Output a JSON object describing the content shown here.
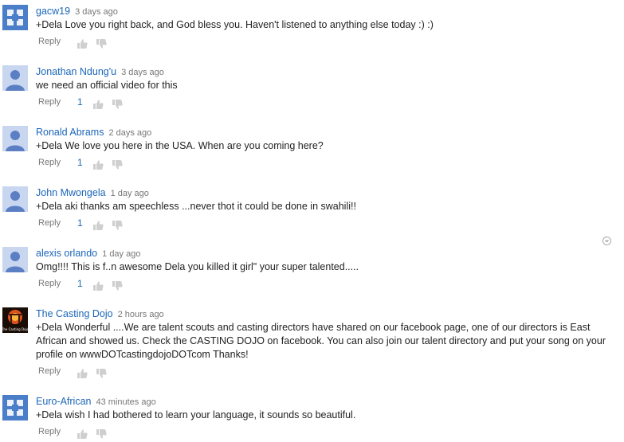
{
  "comments": [
    {
      "author": "gacw19",
      "time": "3 days ago",
      "text": "+Dela Love you right back, and God bless you. Haven't listened to anything else today :) :)",
      "reply_label": "Reply",
      "likes": "",
      "avatar": "blue"
    },
    {
      "author": "Jonathan Ndung'u",
      "time": "3 days ago",
      "text": "we need an official video for this",
      "reply_label": "Reply",
      "likes": "1",
      "avatar": "person"
    },
    {
      "author": "Ronald Abrams",
      "time": "2 days ago",
      "text": "+Dela We love you here in the USA.  When are you coming here?",
      "reply_label": "Reply",
      "likes": "1",
      "avatar": "person"
    },
    {
      "author": "John Mwongela",
      "time": "1 day ago",
      "text": "+Dela aki thanks  am speechless ...never thot it could be done in swahili!!",
      "reply_label": "Reply",
      "likes": "1",
      "avatar": "person"
    },
    {
      "author": "alexis orlando",
      "time": "1 day ago",
      "text": "Omg!!!! This is f..n awesome Dela you killed it girl\" your super talented.....",
      "reply_label": "Reply",
      "likes": "1",
      "avatar": "person"
    },
    {
      "author": "The Casting Dojo",
      "time": "2 hours ago",
      "text": "+Dela Wonderful ....We are talent scouts and casting directors have shared on our facebook page, one of our directors is East African and showed us. Check the CASTING DOJO on facebook. You can also join our talent directory and put your song on your profile on wwwDOTcastingdojoDOTcom  Thanks!",
      "reply_label": "Reply",
      "likes": "",
      "avatar": "dojo",
      "avatar_caption": "The Casting Dojo"
    },
    {
      "author": "Euro-African",
      "time": "43 minutes ago",
      "text": "+Dela wish I had bothered to learn your language, it sounds so beautiful.",
      "reply_label": "Reply",
      "likes": "",
      "avatar": "blue"
    }
  ],
  "colors": {
    "author": "#1b66b8",
    "avatar_blue": "#4a7ec8",
    "avatar_person": "#5c7fc4",
    "timestamp": "#777777"
  }
}
